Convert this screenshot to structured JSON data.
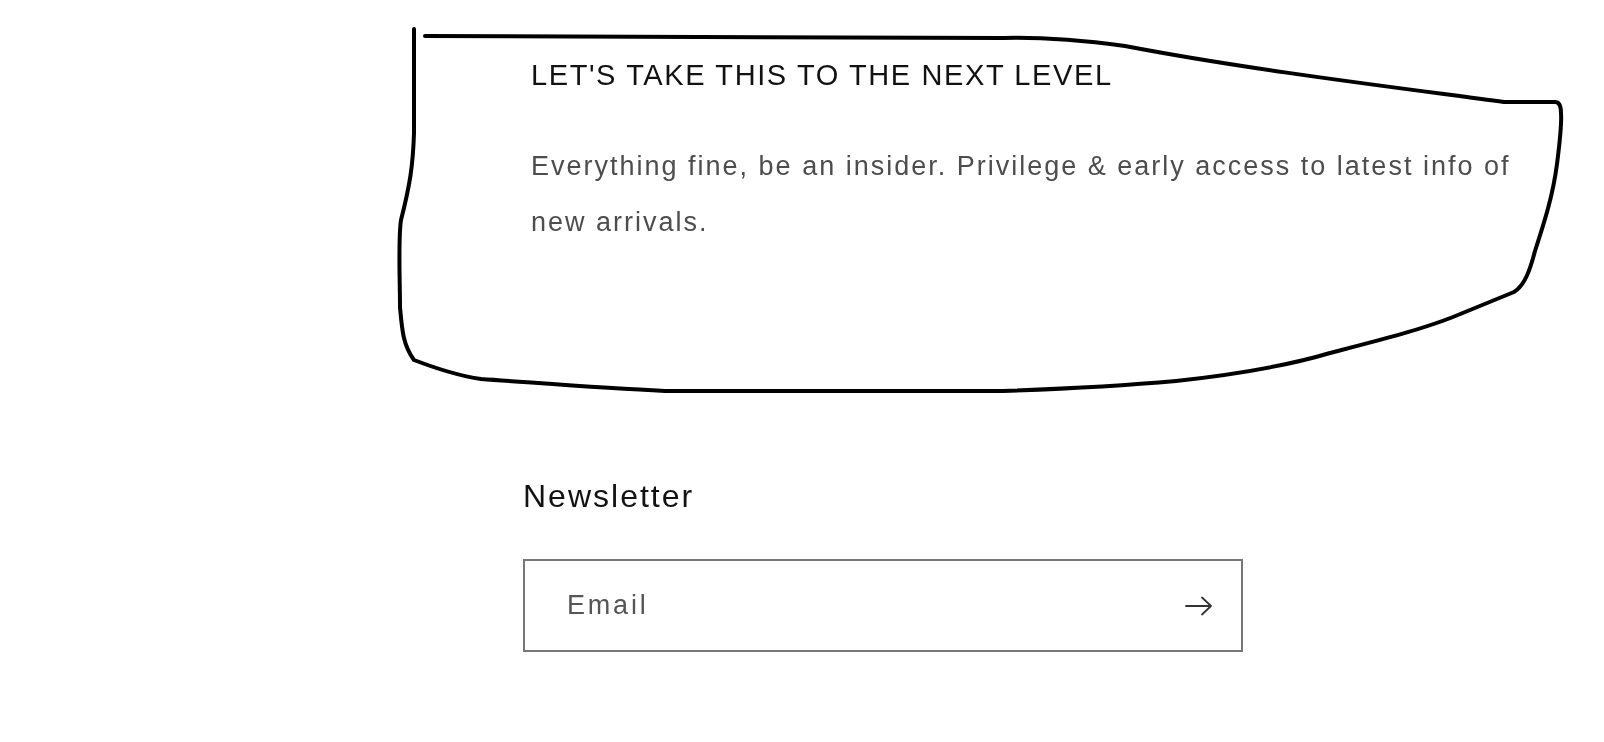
{
  "promo": {
    "heading": "LET'S TAKE THIS TO THE NEXT LEVEL",
    "text": "Everything fine, be an insider. Privilege & early access to latest info of new arrivals."
  },
  "newsletter": {
    "heading": "Newsletter",
    "email": {
      "placeholder": "Email"
    }
  }
}
